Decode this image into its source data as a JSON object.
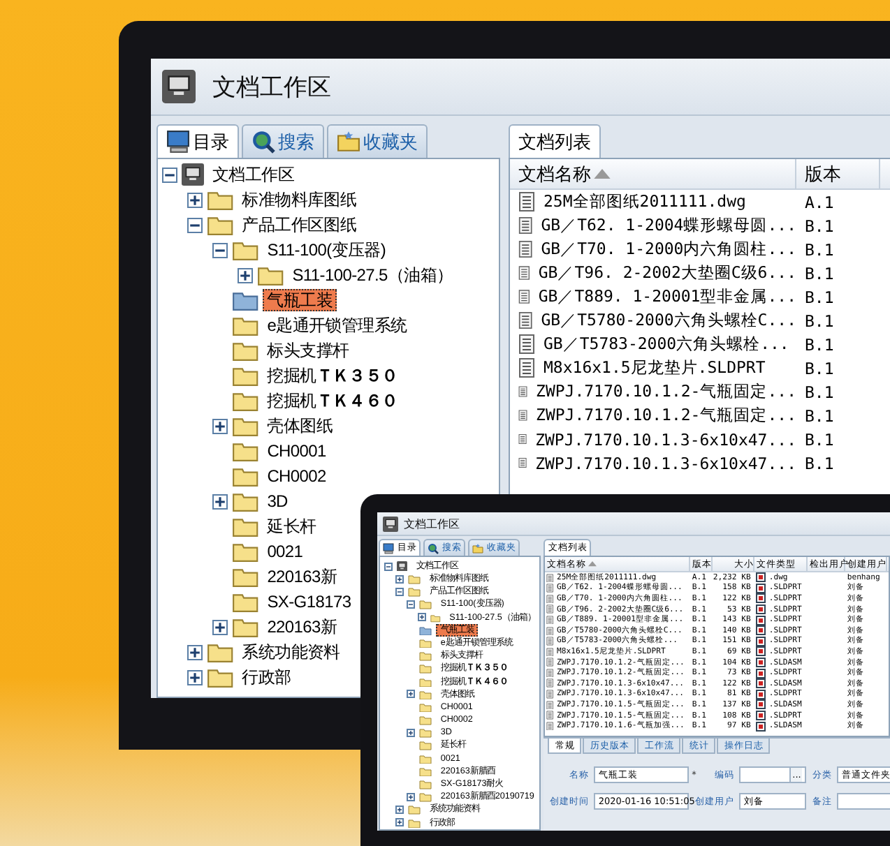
{
  "window": {
    "title": "文档工作区"
  },
  "left_tabs": [
    {
      "label": "目录",
      "selected": true
    },
    {
      "label": "搜索",
      "selected": false
    },
    {
      "label": "收藏夹",
      "selected": false
    }
  ],
  "tree": {
    "label": "文档工作区",
    "expanded": true,
    "selected": false,
    "children": [
      {
        "label": "标准物料库图纸",
        "expanded": false,
        "selected": false
      },
      {
        "label": "产品工作区图纸",
        "expanded": true,
        "selected": false,
        "children": [
          {
            "label": "S11-100(变压器)",
            "expanded": true,
            "selected": false,
            "children": [
              {
                "label": "S11-100-27.5（油箱）",
                "expanded": false,
                "selected": false
              }
            ]
          },
          {
            "label": "气瓶工装",
            "selected": true
          },
          {
            "label": "e匙通开锁管理系统",
            "selected": false
          },
          {
            "label": "标头支撑杆",
            "selected": false
          },
          {
            "label": "挖掘机**ＴＫ３５０**",
            "selected": false
          },
          {
            "label": "挖掘机**ＴＫ４６０**",
            "selected": false
          },
          {
            "label": "壳体图纸",
            "expanded": false,
            "selected": false
          },
          {
            "label": "CH0001",
            "selected": false
          },
          {
            "label": "CH0002",
            "selected": false
          },
          {
            "label": "3D",
            "expanded": false,
            "selected": false
          },
          {
            "label": "延长杆",
            "selected": false
          },
          {
            "label": "0021",
            "selected": false
          },
          {
            "label": "220163新",
            "selected": false
          },
          {
            "label": "SX-G18173",
            "selected": false
          },
          {
            "label": "220163新",
            "expanded": false,
            "selected": false
          }
        ]
      },
      {
        "label": "系统功能资料",
        "expanded": false,
        "selected": false
      },
      {
        "label": "行政部",
        "expanded": false,
        "selected": false
      }
    ]
  },
  "list_tab": {
    "label": "文档列表"
  },
  "list_columns": [
    {
      "label": "文档名称",
      "sorted": true
    },
    {
      "label": "版本"
    }
  ],
  "documents": [
    {
      "name": "25M全部图纸2011111.dwg",
      "version": "A.1"
    },
    {
      "name": "GB／T62. 1-2004蝶形螺母圆...",
      "version": "B.1"
    },
    {
      "name": "GB／T70. 1-2000内六角圆柱...",
      "version": "B.1"
    },
    {
      "name": "GB／T96. 2-2002大垫圈C级6...",
      "version": "B.1"
    },
    {
      "name": "GB／T889. 1-20001型非金属...",
      "version": "B.1"
    },
    {
      "name": "GB／T5780-2000六角头螺栓C...",
      "version": "B.1"
    },
    {
      "name": "GB／T5783-2000六角头螺栓...",
      "version": "B.1"
    },
    {
      "name": "M8x16x1.5尼龙垫片.SLDPRT",
      "version": "B.1"
    },
    {
      "name": "ZWPJ.7170.10.1.2-气瓶固定...",
      "version": "B.1"
    },
    {
      "name": "ZWPJ.7170.10.1.2-气瓶固定...",
      "version": "B.1"
    },
    {
      "name": "ZWPJ.7170.10.1.3-6x10x47...",
      "version": "B.1"
    },
    {
      "name": "ZWPJ.7170.10.1.3-6x10x47...",
      "version": "B.1"
    }
  ],
  "laptop": {
    "title": "文档工作区",
    "left_tabs": [
      {
        "label": "目录",
        "selected": true
      },
      {
        "label": "搜索",
        "selected": false
      },
      {
        "label": "收藏夹",
        "selected": false
      }
    ],
    "tree": {
      "label": "文档工作区",
      "expanded": true,
      "selected": false,
      "children": [
        {
          "label": "标准物料库图纸",
          "expanded": false,
          "selected": false
        },
        {
          "label": "产品工作区图纸",
          "expanded": true,
          "selected": false,
          "children": [
            {
              "label": "S11-100(变压器)",
              "expanded": true,
              "selected": false,
              "children": [
                {
                  "label": "S11-100-27.5（油箱）",
                  "expanded": false,
                  "selected": false
                }
              ]
            },
            {
              "label": "气瓶工装",
              "selected": true
            },
            {
              "label": "e匙通开锁管理系统",
              "selected": false
            },
            {
              "label": "标头支撑杆",
              "selected": false
            },
            {
              "label": "挖掘机**ＴＫ３５０**",
              "selected": false
            },
            {
              "label": "挖掘机**ＴＫ４６０**",
              "selected": false
            },
            {
              "label": "壳体图纸",
              "expanded": false,
              "selected": false
            },
            {
              "label": "CH0001",
              "selected": false
            },
            {
              "label": "CH0002",
              "selected": false
            },
            {
              "label": "3D",
              "expanded": false,
              "selected": false
            },
            {
              "label": "延长杆",
              "selected": false
            },
            {
              "label": "0021",
              "selected": false
            },
            {
              "label": "220163新腊酉",
              "selected": false
            },
            {
              "label": "SX-G18173耐火",
              "selected": false
            },
            {
              "label": "220163新腊酉20190719",
              "expanded": false,
              "selected": false
            }
          ]
        },
        {
          "label": "系统功能资料",
          "expanded": false,
          "selected": false
        },
        {
          "label": "行政部",
          "expanded": false,
          "selected": false
        }
      ]
    },
    "list_tab": {
      "label": "文档列表"
    },
    "list_columns": [
      {
        "label": "文档名称",
        "sorted": true
      },
      {
        "label": "版本"
      },
      {
        "label": "大小"
      },
      {
        "label": "文件类型"
      },
      {
        "label": "检出用户"
      },
      {
        "label": "创建用户"
      }
    ],
    "documents": [
      {
        "name": "25M全部图纸2011111.dwg",
        "version": "A.1",
        "size": "2,232 KB",
        "type": ".dwg",
        "creator": "benhang"
      },
      {
        "name": "GB／T62. 1-2004蝶形螺母圆...",
        "version": "B.1",
        "size": "158 KB",
        "type": ".SLDPRT",
        "creator": "刘备"
      },
      {
        "name": "GB／T70. 1-2000内六角圆柱...",
        "version": "B.1",
        "size": "122 KB",
        "type": ".SLDPRT",
        "creator": "刘备"
      },
      {
        "name": "GB／T96. 2-2002大垫圈C级6...",
        "version": "B.1",
        "size": "53 KB",
        "type": ".SLDPRT",
        "creator": "刘备"
      },
      {
        "name": "GB／T889. 1-20001型非金属...",
        "version": "B.1",
        "size": "143 KB",
        "type": ".SLDPRT",
        "creator": "刘备"
      },
      {
        "name": "GB／T5780-2000六角头螺栓C...",
        "version": "B.1",
        "size": "140 KB",
        "type": ".SLDPRT",
        "creator": "刘备"
      },
      {
        "name": "GB／T5783-2000六角头螺栓...",
        "version": "B.1",
        "size": "151 KB",
        "type": ".SLDPRT",
        "creator": "刘备"
      },
      {
        "name": "M8x16x1.5尼龙垫片.SLDPRT",
        "version": "B.1",
        "size": "69 KB",
        "type": ".SLDPRT",
        "creator": "刘备"
      },
      {
        "name": "ZWPJ.7170.10.1.2-气瓶固定...",
        "version": "B.1",
        "size": "104 KB",
        "type": ".SLDASM",
        "creator": "刘备"
      },
      {
        "name": "ZWPJ.7170.10.1.2-气瓶固定...",
        "version": "B.1",
        "size": "73 KB",
        "type": ".SLDPRT",
        "creator": "刘备"
      },
      {
        "name": "ZWPJ.7170.10.1.3-6x10x47...",
        "version": "B.1",
        "size": "122 KB",
        "type": ".SLDASM",
        "creator": "刘备"
      },
      {
        "name": "ZWPJ.7170.10.1.3-6x10x47...",
        "version": "B.1",
        "size": "81 KB",
        "type": ".SLDPRT",
        "creator": "刘备"
      },
      {
        "name": "ZWPJ.7170.10.1.5-气瓶固定...",
        "version": "B.1",
        "size": "137 KB",
        "type": ".SLDASM",
        "creator": "刘备"
      },
      {
        "name": "ZWPJ.7170.10.1.5-气瓶固定...",
        "version": "B.1",
        "size": "108 KB",
        "type": ".SLDPRT",
        "creator": "刘备"
      },
      {
        "name": "ZWPJ.7170.10.1.6-气瓶加强...",
        "version": "B.1",
        "size": "97 KB",
        "type": ".SLDASM",
        "creator": "刘备"
      }
    ],
    "detail_tabs": [
      {
        "label": "常规",
        "selected": true
      },
      {
        "label": "历史版本",
        "selected": false
      },
      {
        "label": "工作流",
        "selected": false
      },
      {
        "label": "统计",
        "selected": false
      },
      {
        "label": "操作日志",
        "selected": false
      }
    ],
    "fields": [
      {
        "label": "名称",
        "value": "气瓶工装",
        "mark": "*"
      },
      {
        "label": "编码",
        "browse": "..."
      },
      {
        "label": "分类",
        "value": "普通文件夹"
      },
      {
        "label": "创建时间",
        "value": "2020-01-16 10:51:05"
      },
      {
        "label": "创建用户",
        "value": "刘备"
      },
      {
        "label": "备注"
      }
    ]
  }
}
